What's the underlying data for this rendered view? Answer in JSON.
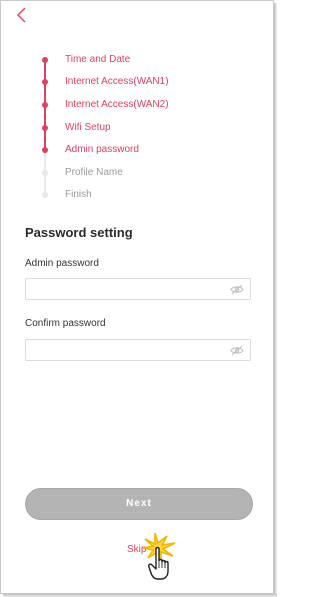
{
  "steps": [
    {
      "label": "Time and Date",
      "state": "done"
    },
    {
      "label": "Internet Access(WAN1)",
      "state": "done"
    },
    {
      "label": "Internet Access(WAN2)",
      "state": "done"
    },
    {
      "label": "Wifi Setup",
      "state": "done"
    },
    {
      "label": "Admin password",
      "state": "current"
    },
    {
      "label": "Profile Name",
      "state": "todo"
    },
    {
      "label": "Finish",
      "state": "todo"
    }
  ],
  "section_title": "Password setting",
  "admin_password": {
    "label": "Admin password",
    "value": ""
  },
  "confirm_password": {
    "label": "Confirm password",
    "value": ""
  },
  "next_label": "Next",
  "skip_label": "Skip",
  "colors": {
    "accent": "#e0405f",
    "inactive": "#9a9a9a",
    "button": "#b4b4b4"
  },
  "icons": {
    "back": "chevron-left-icon",
    "eye": "eye-hidden-icon",
    "cursor": "hand-pointer-click-icon"
  }
}
